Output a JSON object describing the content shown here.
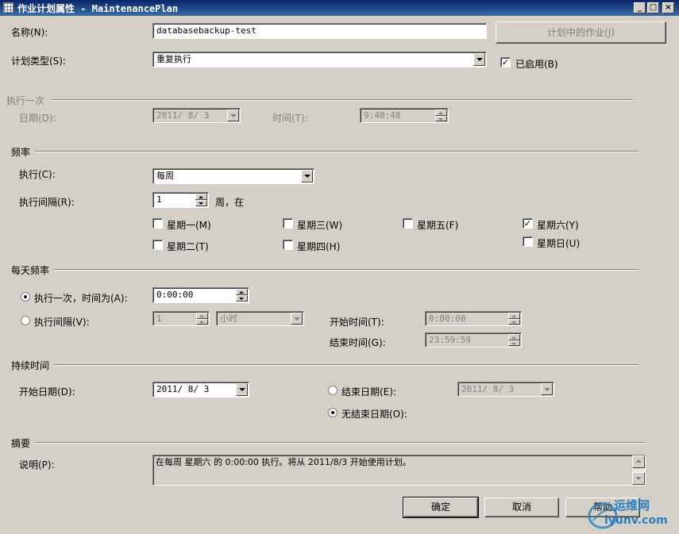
{
  "window": {
    "title": "作业计划属性 - MaintenancePlan",
    "min": "_",
    "max": "□",
    "close": "×"
  },
  "name_label": "名称(N):",
  "name_value": "databasebackup-test",
  "jobs_in_schedule_button": "计划中的作业(J)",
  "schedule_type_label": "计划类型(S):",
  "schedule_type_value": "重复执行",
  "enabled_label": "已启用(B)",
  "enabled_checked": true,
  "one_time": {
    "section": "执行一次",
    "date_label": "日期(D):",
    "date_value": "2011/ 8/ 3",
    "time_label": "时间(T):",
    "time_value": "9:40:48"
  },
  "frequency": {
    "section": "频率",
    "occurs_label": "执行(C):",
    "occurs_value": "每周",
    "recurs_label": "执行间隔(R):",
    "recurs_value": "1",
    "recurs_suffix": "周，在",
    "days": [
      {
        "label": "星期一(M)",
        "checked": false
      },
      {
        "label": "星期三(W)",
        "checked": false
      },
      {
        "label": "星期五(F)",
        "checked": false
      },
      {
        "label": "星期六(Y)",
        "checked": true
      },
      {
        "label": "星期二(T)",
        "checked": false
      },
      {
        "label": "星期四(H)",
        "checked": false
      },
      {
        "label": "星期日(U)",
        "checked": false
      }
    ]
  },
  "daily": {
    "section": "每天频率",
    "once_label": "执行一次，时间为(A):",
    "once_value": "0:00:00",
    "interval_label": "执行间隔(V):",
    "interval_value": "1",
    "interval_unit": "小时",
    "start_label": "开始时间(T):",
    "start_value": "0:00:00",
    "end_label": "结束时间(G):",
    "end_value": "23:59:59"
  },
  "duration": {
    "section": "持续时间",
    "start_label": "开始日期(D):",
    "start_value": "2011/ 8/ 3",
    "end_date_label": "结束日期(E):",
    "end_date_value": "2011/ 8/ 3",
    "no_end_label": "无结束日期(O):"
  },
  "summary": {
    "section": "摘要",
    "desc_label": "说明(P):",
    "desc_value": "在每周 星期六 的 0:00:00 执行。将从 2011/8/3 开始使用计划。"
  },
  "buttons": {
    "ok": "确定",
    "cancel": "取消",
    "help": "帮助"
  },
  "watermark": {
    "brand": "运维网",
    "url": "iyunv.com"
  }
}
